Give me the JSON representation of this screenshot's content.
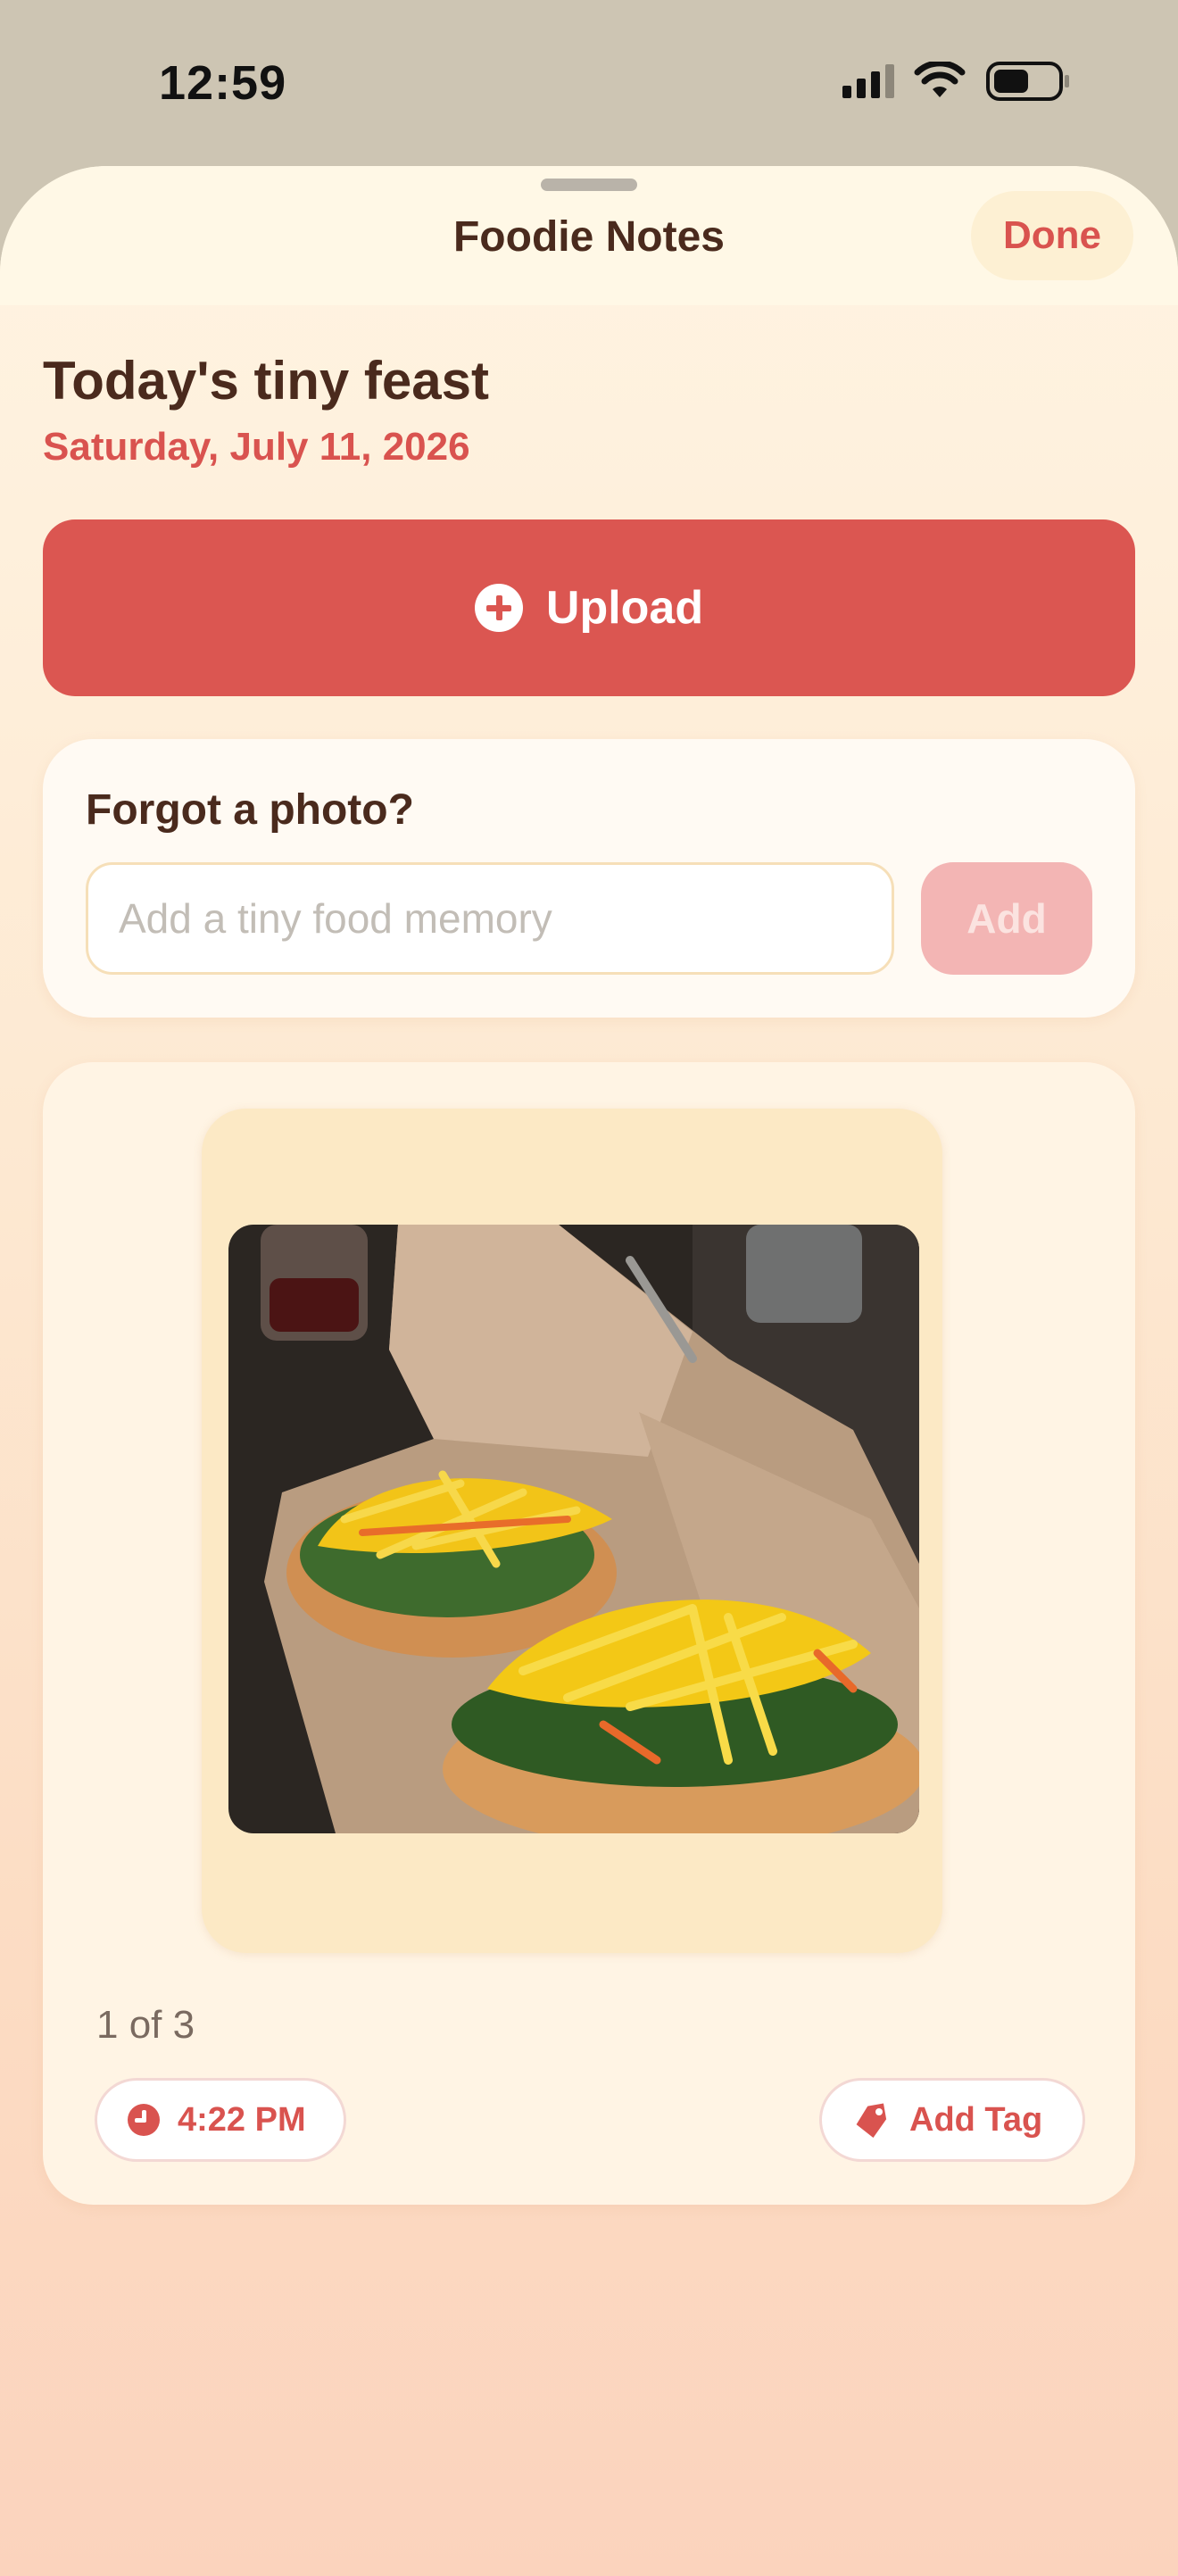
{
  "status_bar": {
    "time": "12:59"
  },
  "nav": {
    "title": "Foodie Notes",
    "done_label": "Done"
  },
  "day": {
    "heading": "Today's tiny feast",
    "date": "Saturday, July 11, 2026"
  },
  "upload": {
    "label": "Upload",
    "icon": "plus-circle-icon"
  },
  "forgot_card": {
    "title": "Forgot a photo?",
    "input_value": "",
    "input_placeholder": "Add a tiny food memory",
    "add_label": "Add"
  },
  "photo_card": {
    "page_indicator": "1 of 3",
    "time_label": "4:22 PM",
    "time_icon": "clock-icon",
    "tag_label": "Add Tag",
    "tag_icon": "tag-icon"
  },
  "colors": {
    "accent": "#db5651",
    "heading": "#4a2a1d",
    "sheet_top": "#fff4e2",
    "sheet_bottom": "#fbd3bd"
  }
}
